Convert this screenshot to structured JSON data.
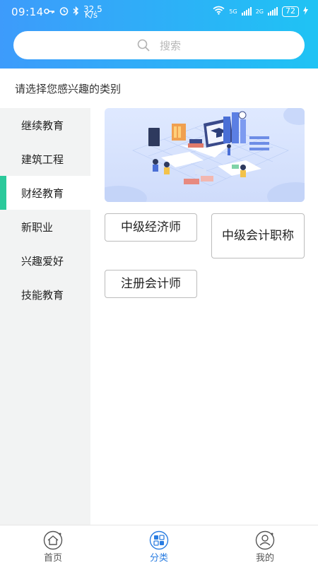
{
  "status": {
    "time": "09:14",
    "net_speed": "32.5\nK/s",
    "sim1": "5G",
    "sim2": "2G",
    "battery": "72"
  },
  "search": {
    "placeholder": "搜索"
  },
  "prompt": "请选择您感兴趣的类别",
  "sidebar": {
    "items": [
      {
        "label": "继续教育"
      },
      {
        "label": "建筑工程"
      },
      {
        "label": "财经教育"
      },
      {
        "label": "新职业"
      },
      {
        "label": "兴趣爱好"
      },
      {
        "label": "技能教育"
      }
    ],
    "active_index": 2,
    "accent_color": "#2bc99b"
  },
  "subcategories": [
    {
      "label": "中级经济师"
    },
    {
      "label": "中级会计职称"
    },
    {
      "label": "注册会计师"
    }
  ],
  "bottom_nav": {
    "items": [
      {
        "label": "首页",
        "icon": "home-icon"
      },
      {
        "label": "分类",
        "icon": "category-icon"
      },
      {
        "label": "我的",
        "icon": "profile-icon"
      }
    ],
    "active_index": 1,
    "active_color": "#2a7de1"
  },
  "colors": {
    "header_gradient_start": "#3d9bfb",
    "header_gradient_end": "#1fc3f4"
  }
}
